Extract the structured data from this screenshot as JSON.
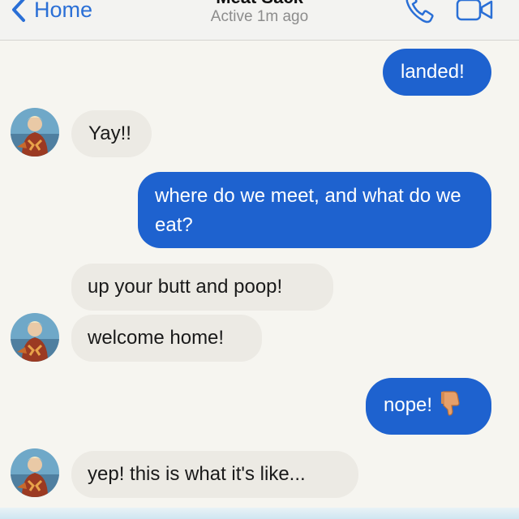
{
  "header": {
    "back_label": "Home",
    "contact_name_partial": "Meat Sack",
    "status": "Active 1m ago",
    "icons": [
      "chevron-left-icon",
      "phone-icon",
      "video-camera-icon"
    ],
    "accent_color": "#2a6fd6"
  },
  "messages": [
    {
      "direction": "outgoing",
      "text": "landed!"
    },
    {
      "direction": "incoming",
      "text": "Yay!!",
      "avatar": true
    },
    {
      "direction": "outgoing",
      "text": "where do we meet, and what do we eat?"
    },
    {
      "direction": "incoming",
      "text": "up your butt and poop!",
      "avatar": false
    },
    {
      "direction": "incoming",
      "text": "welcome home!",
      "avatar": true
    },
    {
      "direction": "outgoing",
      "text": "nope!",
      "emoji": "thumbs-down-icon"
    },
    {
      "direction": "incoming",
      "text": "yep! this is what it's like...",
      "avatar": true
    }
  ],
  "colors": {
    "outgoing_bubble": "#1e62cf",
    "incoming_bubble": "#eceae4",
    "background": "#f6f5f0"
  }
}
